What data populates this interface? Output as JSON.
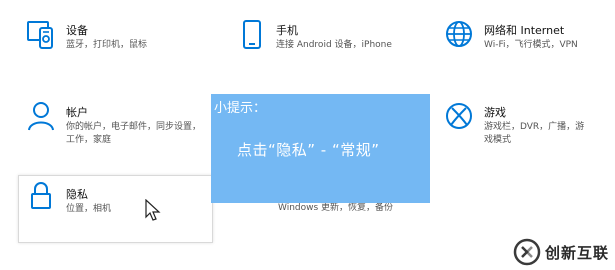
{
  "tiles": [
    {
      "title": "设备",
      "sub": "蓝牙，打印机，鼠标",
      "icon": "devices-icon"
    },
    {
      "title": "手机",
      "sub": "连接 Android 设备，iPhone",
      "icon": "phone-icon"
    },
    {
      "title": "网络和 Internet",
      "sub": "Wi-Fi，飞行模式，VPN",
      "icon": "globe-icon"
    },
    {
      "title": "帐户",
      "sub1": "你的帐户，电子邮件，同步设置，",
      "sub2": "工作，家庭",
      "icon": "person-icon"
    },
    {
      "title": "游戏",
      "sub1": "游戏栏，DVR，广播，游",
      "sub2": "戏模式",
      "icon": "xbox-icon"
    },
    {
      "title": "隐私",
      "sub": "位置，相机",
      "icon": "lock-icon"
    },
    {
      "sub": "Windows 更新，恢复，备份"
    }
  ],
  "tip": {
    "title": "小提示：",
    "text": "点击“隐私” - “常规”"
  },
  "watermark": {
    "text": "创新互联"
  },
  "colors": {
    "accent": "#0078d7",
    "tip_bg": "#74b8f3"
  }
}
